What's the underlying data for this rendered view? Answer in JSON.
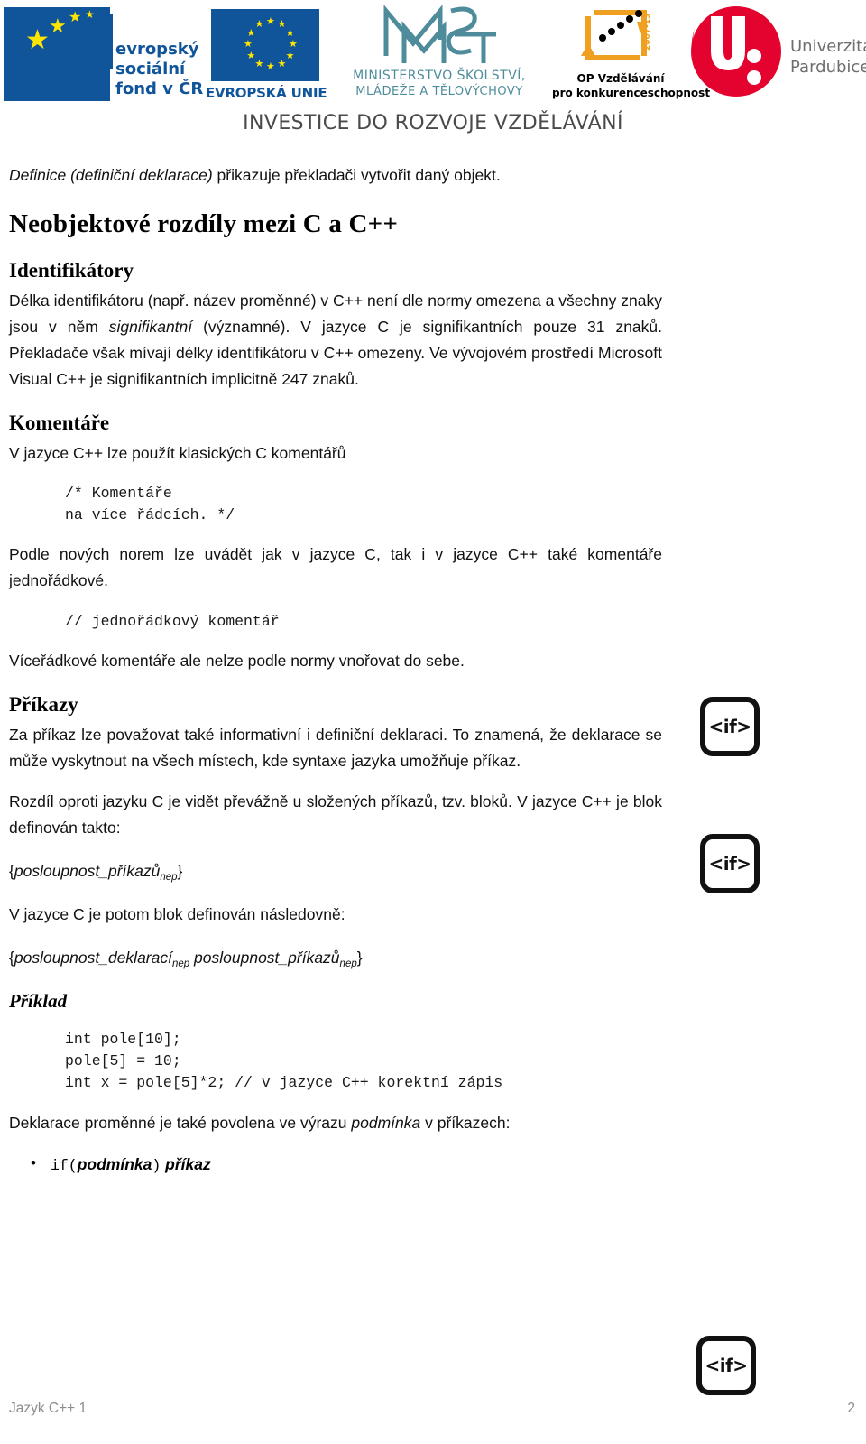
{
  "header": {
    "logos": [
      {
        "name": "esf",
        "letters": "esf",
        "lines": [
          "evropský",
          "sociální",
          "fond v ČR"
        ]
      },
      {
        "name": "european-union",
        "caption": "EVROPSKÁ UNIE"
      },
      {
        "name": "msmt",
        "line1": "MINISTERSTVO ŠKOLSTVÍ,",
        "line2": "MLÁDEŽE A TĚLOVÝCHOVY"
      },
      {
        "name": "op-vzdelavani",
        "line1": "OP Vzdělávání",
        "line2": "pro konkurenceschopnost",
        "mark_label": "2007-13"
      },
      {
        "name": "univerzita-pardubice",
        "line1": "Univerzita",
        "line2": "Pardubice"
      }
    ],
    "tagline": "INVESTICE DO ROZVOJE VZDĚLÁVÁNÍ",
    "colors": {
      "esf_blue": "#10559A",
      "eu_yellow": "#FFE600",
      "msmt_teal": "#4E8C9B",
      "opv_orange": "#F0A020",
      "upce_red": "#E3032E",
      "tagline_gray": "#4A4A4A"
    }
  },
  "document": {
    "intro": {
      "italic_lead": "Definice (definiční deklarace)",
      "rest": " přikazuje překladači vytvořit daný objekt."
    },
    "main_heading": "Neobjektové rozdíly mezi C a C++",
    "sections": [
      {
        "heading": "Identifikátory",
        "paragraph_parts": {
          "p1": "Délka identifikátoru (např. název proměnné) v C++ není dle normy omezena a všechny znaky jsou v něm ",
          "p1_italic": "signifikantní",
          "p2": " (významné). V jazyce C je signifikantních pouze 31 znaků. Překladače však mívají délky identifikátoru v C++ omezeny. Ve vývojovém prostředí Microsoft Visual C++ je signifikantních implicitně 247 znaků."
        }
      },
      {
        "heading": "Komentáře",
        "lead": "V jazyce C++ lze použít klasických C komentářů",
        "code_block_1": "/* Komentáře\nna více řádcích. */",
        "paragraph_2": "Podle nových norem lze uvádět jak v jazyce C, tak i v jazyce C++ také komentáře jednořádkové.",
        "code_block_2": "// jednořádkový komentář",
        "paragraph_3": "Víceřádkové komentáře ale nelze podle normy vnořovat do sebe."
      },
      {
        "heading": "Příkazy",
        "paragraph_1": "Za příkaz lze považovat také informativní i definiční deklaraci. To znamená, že deklarace se může vyskytnout na všech místech, kde syntaxe jazyka umožňuje příkaz.",
        "paragraph_2": "Rozdíl oproti jazyku C je vidět převážně u složených příkazů, tzv. bloků. V jazyce C++ je blok definován takto:",
        "blockdef_1": {
          "open": "{",
          "term1": "posloupnost_příkazů",
          "sub1": "nep",
          "close": "}"
        },
        "paragraph_3": "V jazyce C je potom blok definován následovně:",
        "blockdef_2": {
          "open": "{",
          "term1": "posloupnost_deklarací",
          "sub1": "nep",
          "term2": " posloupnost_příkazů",
          "sub2": "nep",
          "close": "}"
        }
      },
      {
        "heading": "Příklad",
        "code_block_3": "int pole[10];\npole[5] = 10;\nint x = pole[5]*2; // v jazyce C++ korektní zápis",
        "paragraph_after": {
          "a": "Deklarace proměnné je také povolena ve výrazu ",
          "italic": "podmínka",
          "b": " v příkazech:"
        },
        "bullets": [
          {
            "mono": "if(",
            "italic1": "podmínka",
            "mono2": ")",
            "italic2": " příkaz"
          }
        ]
      }
    ],
    "margin_icons": [
      {
        "label": "<if>"
      },
      {
        "label": "<if>"
      },
      {
        "label": "<if>"
      }
    ]
  },
  "footer": {
    "left": "Jazyk C++ 1",
    "page_number": "2"
  }
}
